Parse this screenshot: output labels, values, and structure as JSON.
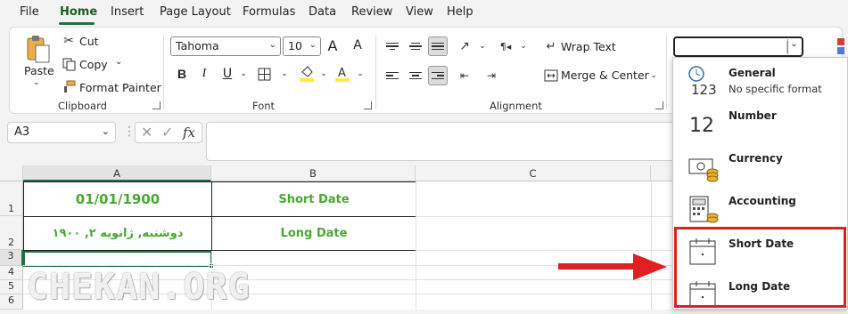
{
  "menu": [
    "File",
    "Home",
    "Insert",
    "Page Layout",
    "Formulas",
    "Data",
    "Review",
    "View",
    "Help"
  ],
  "clipboard": {
    "paste": "Paste",
    "cut": "Cut",
    "copy": "Copy",
    "format_painter": "Format Painter",
    "group_label": "Clipboard"
  },
  "font": {
    "name": "Tahoma",
    "size": "10",
    "grow": "A",
    "shrink": "A",
    "bold": "B",
    "italic": "I",
    "underline": "U",
    "group_label": "Font",
    "fill_color": "#ffeb3b",
    "font_color": "#ffeb3b"
  },
  "alignment": {
    "wrap_text": "Wrap Text",
    "merge_center": "Merge & Center",
    "group_label": "Alignment"
  },
  "formula_bar": {
    "name_box": "A3",
    "fx": "fx"
  },
  "columns": [
    "A",
    "B",
    "C"
  ],
  "rows": [
    "1",
    "2",
    "3",
    "4",
    "5",
    "6"
  ],
  "cells": {
    "A1": "01/01/1900",
    "B1": "Short Date",
    "A2": "دوشنبه, ژانویه ۲, ۱۹۰۰",
    "B2": "Long Date"
  },
  "number_formats": [
    {
      "title": "General",
      "subtitle": "No specific format",
      "icon": "clock-123-icon"
    },
    {
      "title": "Number",
      "subtitle": "",
      "icon": "number-12-icon"
    },
    {
      "title": "Currency",
      "subtitle": "",
      "icon": "currency-icon"
    },
    {
      "title": "Accounting",
      "subtitle": "",
      "icon": "accounting-icon"
    },
    {
      "title": "Short Date",
      "subtitle": "",
      "icon": "calendar-icon"
    },
    {
      "title": "Long Date",
      "subtitle": "",
      "icon": "calendar-icon"
    }
  ],
  "number_format_glyph": "123",
  "number_glyph": "12",
  "watermark": "CHEKAN.ORG",
  "colors": {
    "accent_green": "#1e7145",
    "cell_text_green": "#4aa832",
    "highlight_red": "#e02020"
  }
}
